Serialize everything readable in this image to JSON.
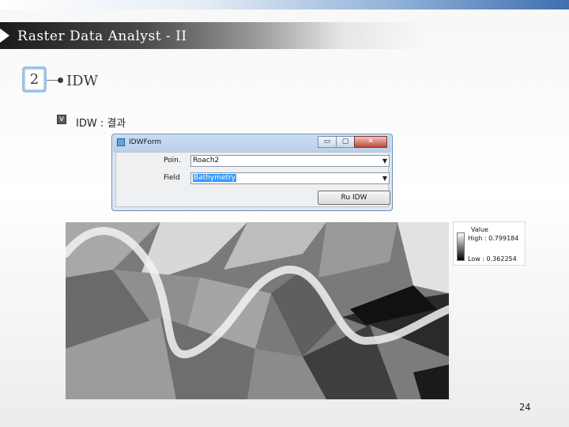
{
  "slide": {
    "title": "Raster Data Analyst - II",
    "section_number": "2",
    "section_title": "IDW",
    "bullet_check": "v",
    "bullet_text": "IDW : 결과",
    "page_number": "24"
  },
  "window": {
    "title": "IDWForm",
    "buttons": {
      "minimize": "▭",
      "maximize": "▢",
      "close": "✕"
    },
    "fields": [
      {
        "label": "Poin.",
        "value": "Roach2"
      },
      {
        "label": "Field",
        "value": "Bathymetry"
      }
    ],
    "run_button": "Ru IDW"
  },
  "legend": {
    "title": "Value",
    "high": "High : 0.799184",
    "low": "Low : 0.362254"
  },
  "colors": {
    "accent": "#3f6fae",
    "selection": "#3399ff"
  }
}
